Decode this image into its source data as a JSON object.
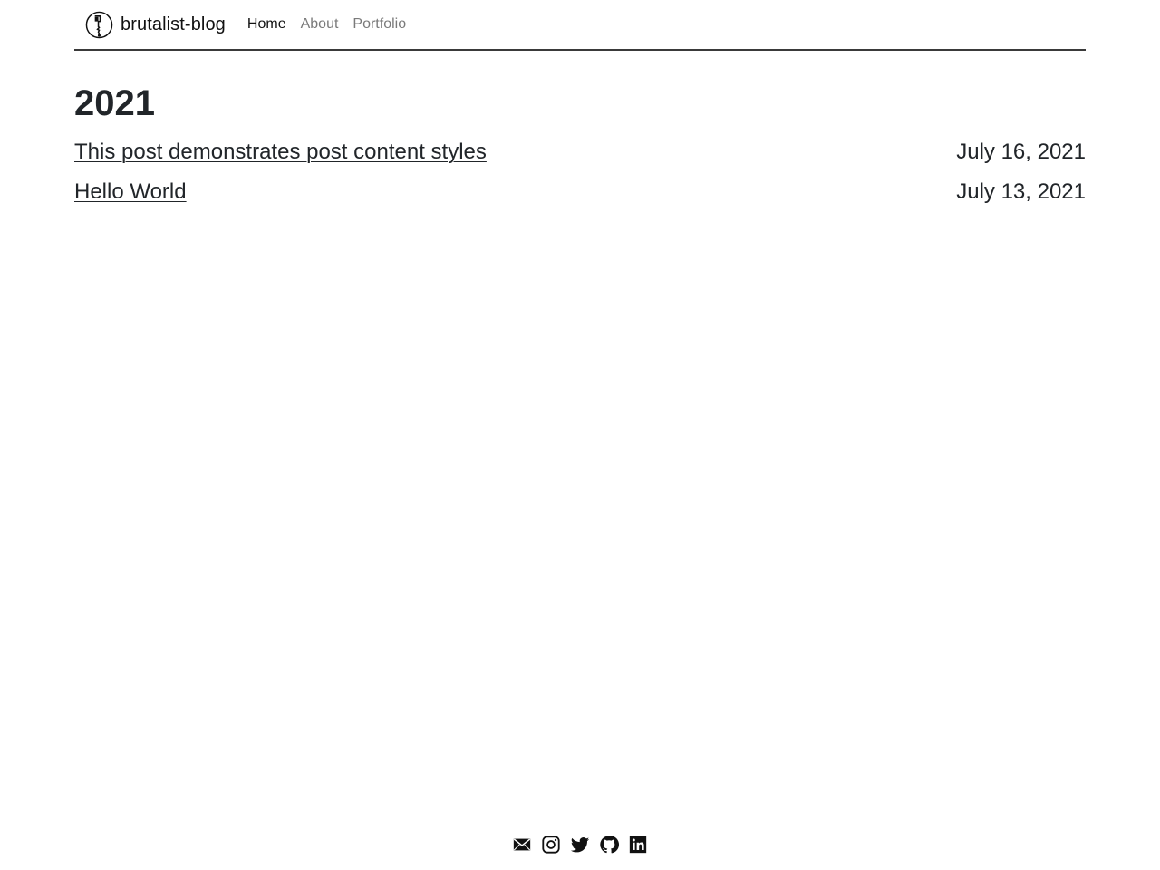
{
  "header": {
    "brand_name": "brutalist-blog",
    "logo_icon": "brutalist-face-logo",
    "nav": [
      {
        "label": "Home",
        "active": true
      },
      {
        "label": "About",
        "active": false
      },
      {
        "label": "Portfolio",
        "active": false
      }
    ]
  },
  "main": {
    "year": "2021",
    "posts": [
      {
        "title": "This post demonstrates post content styles",
        "date": "July 16, 2021"
      },
      {
        "title": "Hello World",
        "date": "July 13, 2021"
      }
    ]
  },
  "footer": {
    "social_icons": [
      "email-icon",
      "instagram-icon",
      "twitter-icon",
      "github-icon",
      "linkedin-icon"
    ]
  },
  "colors": {
    "text": "#212529",
    "nav_inactive": "#7a7a7a",
    "rule": "#3a3a3a",
    "background": "#ffffff"
  }
}
